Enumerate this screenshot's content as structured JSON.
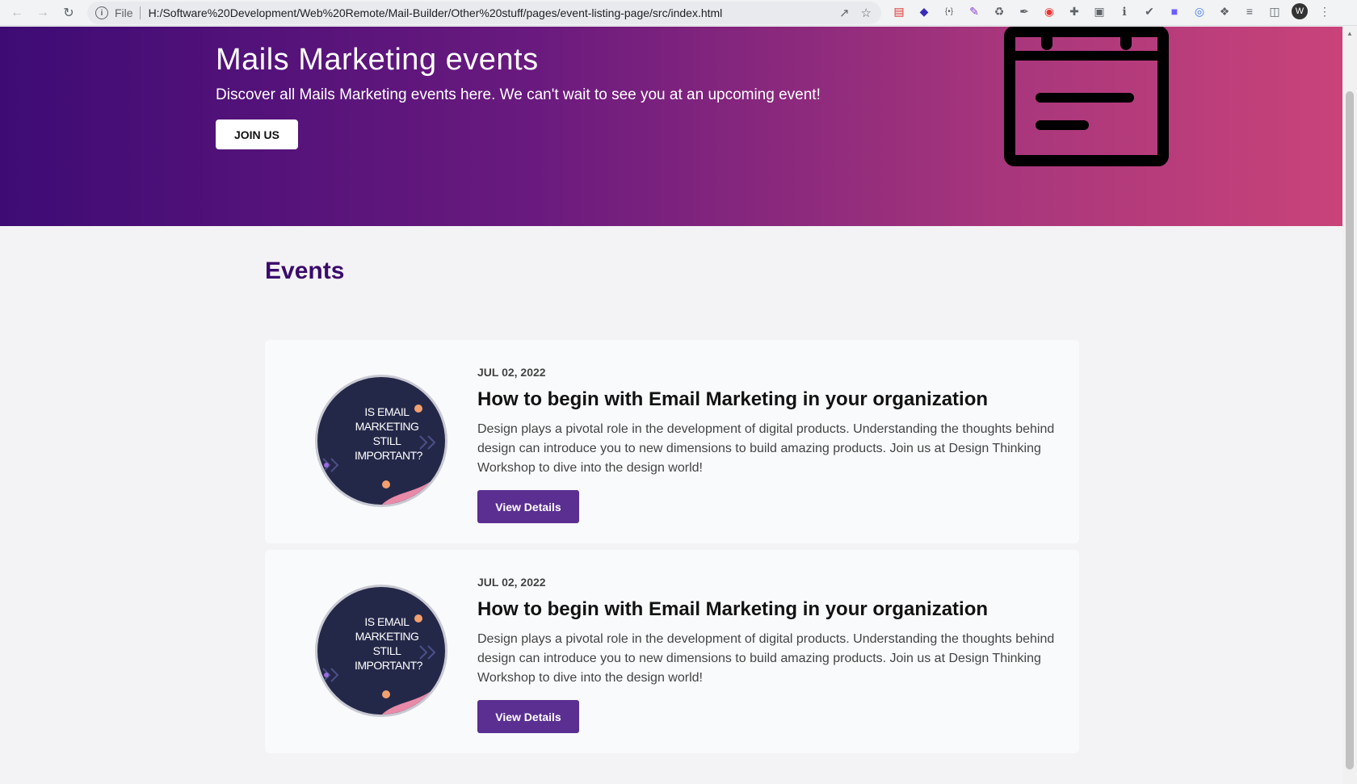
{
  "browser": {
    "scheme_label": "File",
    "url": "H:/Software%20Development/Web%20Remote/Mail-Builder/Other%20stuff/pages/event-listing-page/src/index.html"
  },
  "hero": {
    "title": "Mails Marketing events",
    "subtitle": "Discover all Mails Marketing events here. We can't wait to see you at an upcoming event!",
    "join_label": "JOIN US"
  },
  "events_heading": "Events",
  "events": [
    {
      "date": "JUL 02, 2022",
      "title": "How to begin with Email Marketing in your organization",
      "description": "Design plays a pivotal role in the development of digital products. Understanding the thoughts behind design can introduce you to new dimensions to build amazing products. Join us at Design Thinking Workshop to dive into the design world!",
      "thumb_text": "IS EMAIL MARKETING STILL IMPORTANT?",
      "button_label": "View Details"
    },
    {
      "date": "JUL 02, 2022",
      "title": "How to begin with Email Marketing in your organization",
      "description": "Design plays a pivotal role in the development of digital products. Understanding the thoughts behind design can introduce you to new dimensions to build amazing products. Join us at Design Thinking Workshop to dive into the design world!",
      "thumb_text": "IS EMAIL MARKETING STILL IMPORTANT?",
      "button_label": "View Details"
    }
  ],
  "colors": {
    "hero_start": "#3e0b75",
    "hero_end": "#c9437a",
    "heading": "#3b0a6c",
    "button": "#5a2f91"
  }
}
